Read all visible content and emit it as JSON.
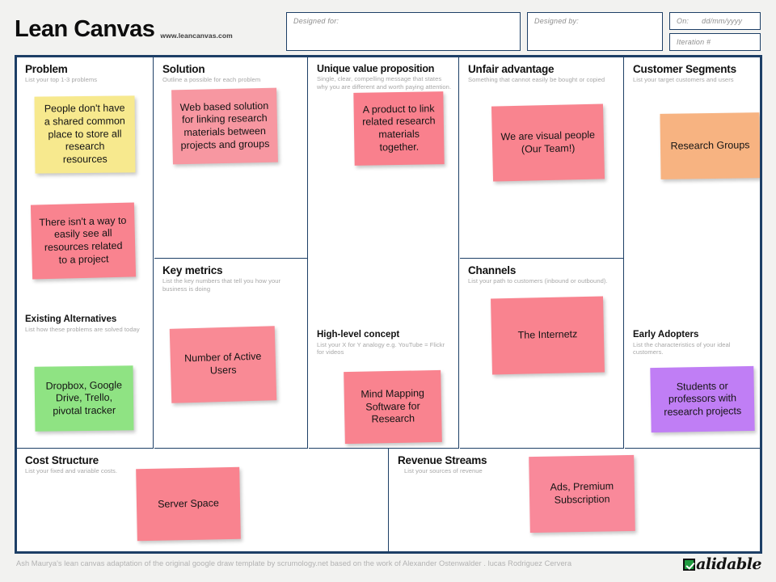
{
  "header": {
    "brand_title": "Lean Canvas",
    "brand_url": "www.leancanvas.com",
    "designed_for_label": "Designed for:",
    "designed_for_value": "",
    "designed_by_label": "Designed by:",
    "designed_by_value": "",
    "on_label": "On:",
    "on_value": "dd/mm/yyyy",
    "iteration_label": "Iteration #",
    "iteration_value": ""
  },
  "cells": {
    "problem": {
      "title": "Problem",
      "subtitle": "List your top 1-3 problems",
      "notes": [
        {
          "text": "People don't have a shared common place to store all research resources",
          "color": "#f7e98e"
        },
        {
          "text": "There isn't a way to easily see all resources related to a project",
          "color": "#f9838f"
        }
      ],
      "sub_section": {
        "title": "Existing Alternatives",
        "subtitle": "List how these problems are solved today",
        "notes": [
          {
            "text": "Dropbox, Google Drive, Trello, pivotal tracker",
            "color": "#8fe383"
          }
        ]
      }
    },
    "solution": {
      "title": "Solution",
      "subtitle": "Outline a possible for each problem",
      "notes": [
        {
          "text": "Web based solution for linking research materials between projects and groups",
          "color": "#f797a1"
        }
      ]
    },
    "key_metrics": {
      "title": "Key metrics",
      "subtitle": "List the key numbers that tell you how your business is doing",
      "notes": [
        {
          "text": "Number of Active Users",
          "color": "#f98a95"
        }
      ]
    },
    "uvp": {
      "title": "Unique value proposition",
      "subtitle": "Single, clear, compelling message that states why you are different and worth paying attention.",
      "notes": [
        {
          "text": "A product to link related research materials together.",
          "color": "#f9808d"
        }
      ]
    },
    "high_level_concept": {
      "title": "High-level concept",
      "subtitle": "List your X for Y analogy e.g. YouTube = Flickr for videos",
      "notes": [
        {
          "text": "Mind Mapping Software for Research",
          "color": "#f9838f"
        }
      ]
    },
    "unfair_advantage": {
      "title": "Unfair advantage",
      "subtitle": "Something that cannot easily be bought or copied",
      "notes": [
        {
          "text": "We are visual people (Our Team!)",
          "color": "#f9848f"
        }
      ]
    },
    "channels": {
      "title": "Channels",
      "subtitle": "List your path to customers (inbound or outbound).",
      "notes": [
        {
          "text": "The Internetz",
          "color": "#f9838f"
        }
      ]
    },
    "customer_segments": {
      "title": "Customer Segments",
      "subtitle": "List your target customers and users",
      "notes": [
        {
          "text": "Research Groups",
          "color": "#f7b381"
        }
      ],
      "sub_section": {
        "title": "Early Adopters",
        "subtitle": "List the characteristics of your ideal customers.",
        "notes": [
          {
            "text": "Students or professors with research projects",
            "color": "#c07ef5"
          }
        ]
      }
    },
    "cost_structure": {
      "title": "Cost Structure",
      "subtitle": "List your fixed and variable costs.",
      "notes": [
        {
          "text": "Server Space",
          "color": "#f9838f"
        }
      ]
    },
    "revenue_streams": {
      "title": "Revenue Streams",
      "subtitle": "List your sources of revenue",
      "notes": [
        {
          "text": "Ads, Premium Subscription",
          "color": "#f9899a"
        }
      ]
    }
  },
  "footer": {
    "credit": "Ash Maurya's lean canvas adaptation of the original google draw template by scrumology.net based on the work of Alexander Ostenwalder . lucas Rodriguez Cervera",
    "logo_text": "alidable",
    "logo_icon": "checkbox-checked-icon"
  }
}
